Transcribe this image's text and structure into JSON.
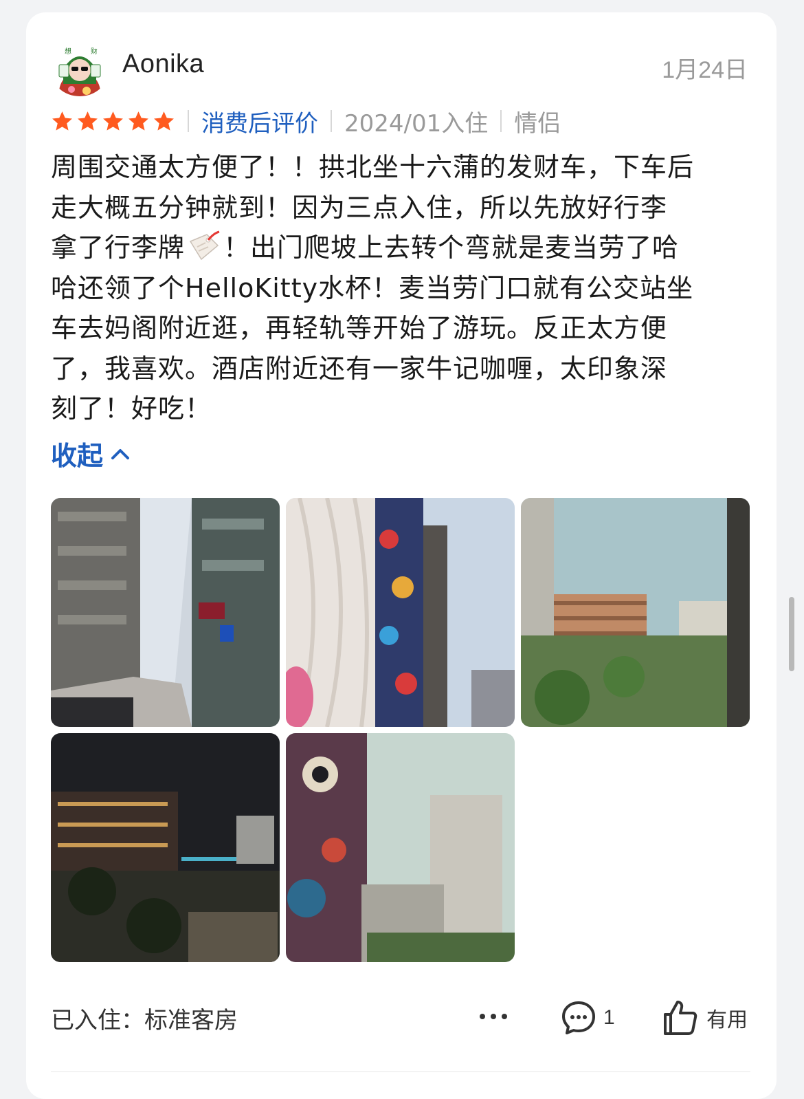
{
  "review": {
    "user": {
      "name": "Aonika",
      "avatar_icon": "avatar-icon"
    },
    "date": "1月24日",
    "rating": 5,
    "tags": {
      "review_type": "消费后评价",
      "stay_date": "2024/01入住",
      "trip_type": "情侣"
    },
    "text_lines": [
      "周围交通太方便了！！拱北坐十六蒲的发财车，下车后",
      "走大概五分钟就到！因为三点入住，所以先放好行李",
      "拿了行李牌",
      "！出门爬坡上去转个弯就是麦当劳了哈",
      "哈还领了个HelloKitty水杯！麦当劳门口就有公交站坐",
      "车去妈阁附近逛，再轻轨等开始了游玩。反正太方便",
      "了，我喜欢。酒店附近还有一家牛记咖喱，太印象深",
      "刻了！好吃！"
    ],
    "collapse_label": "收起",
    "photos_count": 5,
    "room": "已入住：标准客房",
    "reply_count": "1",
    "useful_label": "有用"
  },
  "colors": {
    "accent_blue": "#1f5fbf",
    "star_orange": "#ff5a1f",
    "muted_gray": "#9a9a9a"
  },
  "icons": [
    "star-icon",
    "chevron-up-icon",
    "more-icon",
    "comment-icon",
    "thumbs-up-icon",
    "tag-emoji-icon"
  ]
}
